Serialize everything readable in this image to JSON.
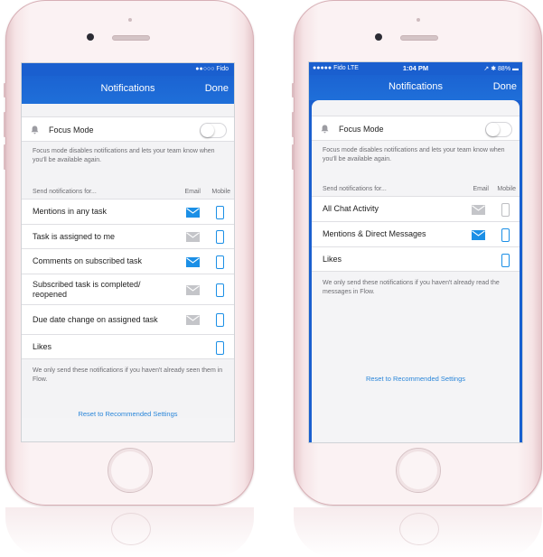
{
  "colors": {
    "brand_blue": "#1b63d2",
    "icon_on": "#1b8fe6",
    "icon_off": "#c4c5c9",
    "link": "#2a86d9"
  },
  "left": {
    "statusbar": {
      "carrier": "●●○○○ Fido"
    },
    "navbar": {
      "title": "Notifications",
      "done": "Done"
    },
    "focus": {
      "label": "Focus Mode",
      "enabled": false,
      "icon": "bell-icon",
      "note": "Focus mode disables notifications and lets your team know when you'll be available again."
    },
    "section": {
      "header": "Send notifications for...",
      "email_col": "Email",
      "mobile_col": "Mobile"
    },
    "rows": [
      {
        "label": "Mentions in any task",
        "email": "on",
        "mobile": "on"
      },
      {
        "label": "Task is assigned to me",
        "email": "off",
        "mobile": "on"
      },
      {
        "label": "Comments on subscribed task",
        "email": "on",
        "mobile": "on"
      },
      {
        "label": "Subscribed task is completed/ reopened",
        "email": "off",
        "mobile": "on"
      },
      {
        "label": "Due date change on assigned task",
        "email": "off",
        "mobile": "on"
      },
      {
        "label": "Likes",
        "email": null,
        "mobile": "on"
      }
    ],
    "footer_note": "We only send these notifications if you haven't already seen them in Flow.",
    "reset": "Reset to Recommended Settings"
  },
  "right": {
    "statusbar": {
      "carrier": "●●●●● Fido  LTE",
      "time": "1:04 PM",
      "battery": "↗ ✱ 88% ▬"
    },
    "navbar": {
      "title": "Notifications",
      "done": "Done"
    },
    "focus": {
      "label": "Focus Mode",
      "enabled": false,
      "icon": "bell-icon",
      "note": "Focus mode disables notifications and lets your team know when you'll be available again."
    },
    "section": {
      "header": "Send notifications for...",
      "email_col": "Email",
      "mobile_col": "Mobile"
    },
    "rows": [
      {
        "label": "All Chat Activity",
        "email": "off",
        "mobile": "off"
      },
      {
        "label": "Mentions & Direct Messages",
        "email": "on",
        "mobile": "on"
      },
      {
        "label": "Likes",
        "email": null,
        "mobile": "on"
      }
    ],
    "footer_note": "We only send these notifications if you haven't already read the messages in Flow.",
    "reset": "Reset to Recommended Settings"
  }
}
